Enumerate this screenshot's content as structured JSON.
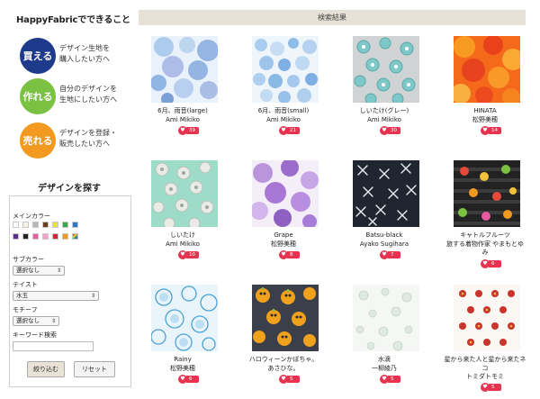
{
  "sidebar": {
    "title": "HappyFabricでできること",
    "features": [
      {
        "circle": "買える",
        "color": "#1e3a8a",
        "line1": "デザイン生地を",
        "line2": "購入したい方へ"
      },
      {
        "circle": "作れる",
        "color": "#7cc242",
        "line1": "自分のデザインを",
        "line2": "生地にしたい方へ"
      },
      {
        "circle": "売れる",
        "color": "#f29a1f",
        "line1": "デザインを登録・",
        "line2": "販売したい方へ"
      }
    ],
    "search_heading": "デザインを探す",
    "main_color_label": "メインカラー",
    "swatches_row1": [
      "#ffffff",
      "#f6f2e4",
      "#b8b8b8",
      "#6b3f22",
      "#e9e03a",
      "#3aa64a",
      "#2f78c9"
    ],
    "swatches_row2": [
      "#5a2d91",
      "#222222",
      "#e85aa0",
      "#f0a4c8",
      "#d4243a",
      "#f29a1f",
      "#multi"
    ],
    "sub_color_label": "サブカラー",
    "sub_color_value": "選択なし",
    "taste_label": "テイスト",
    "taste_value": "水玉",
    "motif_label": "モチーフ",
    "motif_value": "選択なし",
    "keyword_label": "キーワード検索",
    "keyword_value": "",
    "narrow_button": "絞り込む",
    "reset_button": "リセット"
  },
  "results": {
    "title": "検索結果",
    "items": [
      {
        "name": "6月、雨音(large)",
        "author": "Ami Mikiko",
        "likes": "39",
        "pattern": "watercolor-blue-large"
      },
      {
        "name": "6月、雨音(small)",
        "author": "Ami Mikiko",
        "likes": "21",
        "pattern": "watercolor-blue-small"
      },
      {
        "name": "しいたけ(グレー)",
        "author": "Ami Mikiko",
        "likes": "30",
        "pattern": "shiitake-grey"
      },
      {
        "name": "HINATA",
        "author": "松野美穂",
        "likes": "14",
        "pattern": "hinata-orange"
      },
      {
        "name": "しいたけ",
        "author": "Ami Mikiko",
        "likes": "10",
        "pattern": "shiitake-mint"
      },
      {
        "name": "Grape",
        "author": "松野美穂",
        "likes": "8",
        "pattern": "grape-purple"
      },
      {
        "name": "Batsu-black",
        "author": "Ayako Sugihara",
        "likes": "7",
        "pattern": "batsu-black"
      },
      {
        "name": "キャトルフルーツ",
        "author": "旅する着物作家 やまもとゆ",
        "author2": "み",
        "likes": "6",
        "pattern": "fruits-stripe"
      },
      {
        "name": "Rainy",
        "author": "松野美穂",
        "likes": "6",
        "pattern": "rainy-blue"
      },
      {
        "name": "ハロウィーンかぼちゃ。",
        "author": "あさひな。",
        "likes": "5",
        "pattern": "halloween"
      },
      {
        "name": "水滴",
        "author": "一柳綾乃",
        "likes": "5",
        "pattern": "waterdrop"
      },
      {
        "name": "星から来た人と星から来たネ",
        "author": "コ",
        "author2": "トミダトモミ",
        "likes": "5",
        "pattern": "stars-red"
      }
    ]
  }
}
